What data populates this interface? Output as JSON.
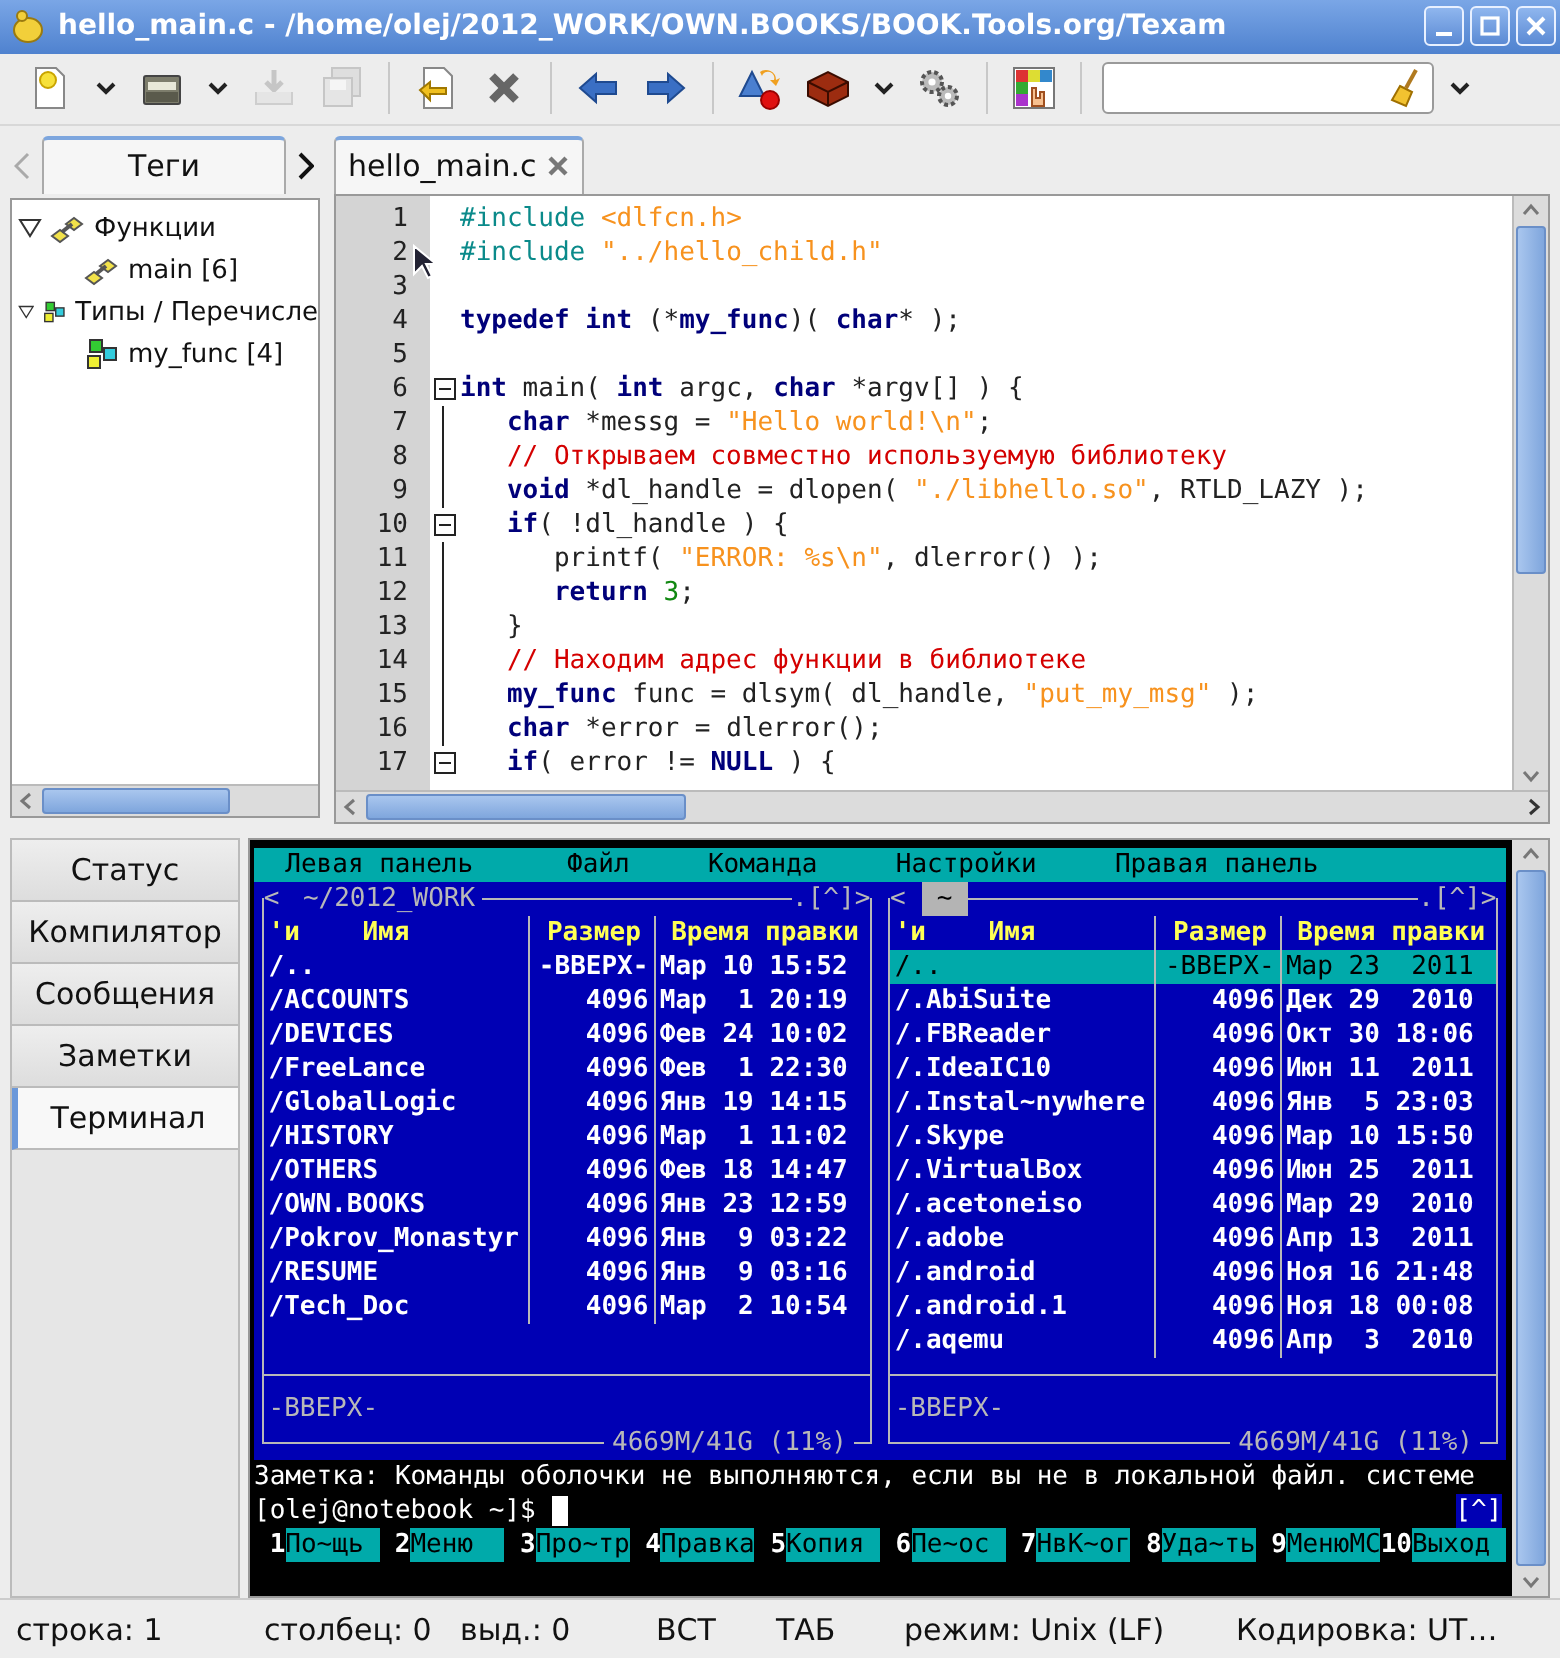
{
  "window": {
    "title": "hello_main.c - /home/olej/2012_WORK/OWN.BOOKS/BOOK.Tools.org/Texam"
  },
  "toolbar": {
    "buttons": [
      {
        "disabled": false
      },
      {
        "disabled": false
      },
      {
        "disabled": true
      },
      {
        "disabled": true
      },
      {
        "disabled": false
      },
      {
        "disabled": false
      },
      {
        "disabled": false
      },
      {
        "disabled": false
      },
      {
        "disabled": false
      },
      {
        "disabled": false
      },
      {
        "disabled": false
      },
      {
        "disabled": false
      }
    ]
  },
  "sidebar": {
    "tab": {
      "label": "Теги",
      "selected": true
    },
    "tree": [
      {
        "label": "Функции",
        "kind": "function",
        "expanded": true,
        "children": [
          {
            "label": "main [6]",
            "kind": "function"
          }
        ]
      },
      {
        "label": "Типы / Перечисле",
        "kind": "type",
        "expanded": true,
        "children": [
          {
            "label": "my_func [4]",
            "kind": "type"
          }
        ]
      }
    ]
  },
  "editor": {
    "tabs": [
      {
        "label": "hello_main.c",
        "selected": true
      }
    ],
    "lines": [
      {
        "number": "1",
        "fold": false,
        "tokens": [
          {
            "text": "#include ",
            "kind": "pre"
          },
          {
            "text": "<dlfcn.h>",
            "kind": "str"
          }
        ]
      },
      {
        "number": "2",
        "fold": false,
        "tokens": [
          {
            "text": "#include ",
            "kind": "pre"
          },
          {
            "text": "\"../hello_child.h\"",
            "kind": "str"
          }
        ]
      },
      {
        "number": "3",
        "fold": false
      },
      {
        "number": "4",
        "fold": false,
        "tokens": [
          {
            "text": "typedef int",
            "kind": "kw"
          },
          {
            "text": " (*",
            "kind": "tx"
          },
          {
            "text": "my_func",
            "kind": "kw"
          },
          {
            "text": ")( ",
            "kind": "tx"
          },
          {
            "text": "char",
            "kind": "kw"
          },
          {
            "text": "* );",
            "kind": "tx"
          }
        ]
      },
      {
        "number": "5",
        "fold": false
      },
      {
        "number": "6",
        "fold": true,
        "tokens": [
          {
            "text": "int",
            "kind": "kw"
          },
          {
            "text": " main( ",
            "kind": "tx"
          },
          {
            "text": "int",
            "kind": "kw"
          },
          {
            "text": " argc, ",
            "kind": "tx"
          },
          {
            "text": "char",
            "kind": "kw"
          },
          {
            "text": " *argv[] ) {",
            "kind": "tx"
          }
        ]
      },
      {
        "number": "7",
        "fold": false,
        "tokens": [
          {
            "text": "   char",
            "kind": "kw"
          },
          {
            "text": " *messg = ",
            "kind": "tx"
          },
          {
            "text": "\"Hello world!\\n\"",
            "kind": "str"
          },
          {
            "text": ";",
            "kind": "tx"
          }
        ]
      },
      {
        "number": "8",
        "fold": false,
        "tokens": [
          {
            "text": "   // Открываем совместно используемую библиотеку",
            "kind": "cm"
          }
        ]
      },
      {
        "number": "9",
        "fold": false,
        "tokens": [
          {
            "text": "   void",
            "kind": "kw"
          },
          {
            "text": " *dl_handle = dlopen( ",
            "kind": "tx"
          },
          {
            "text": "\"./libhello.so\"",
            "kind": "str"
          },
          {
            "text": ", RTLD_LAZY );",
            "kind": "tx"
          }
        ]
      },
      {
        "number": "10",
        "fold": true,
        "tokens": [
          {
            "text": "   if",
            "kind": "kw"
          },
          {
            "text": "( !dl_handle ) {",
            "kind": "tx"
          }
        ]
      },
      {
        "number": "11",
        "fold": false,
        "tokens": [
          {
            "text": "      printf( ",
            "kind": "tx"
          },
          {
            "text": "\"ERROR: %s\\n\"",
            "kind": "str"
          },
          {
            "text": ", dlerror() );",
            "kind": "tx"
          }
        ]
      },
      {
        "number": "12",
        "fold": false,
        "tokens": [
          {
            "text": "      return",
            "kind": "kw"
          },
          {
            "text": " 3",
            "kind": "num"
          },
          {
            "text": ";",
            "kind": "tx"
          }
        ]
      },
      {
        "number": "13",
        "fold": false,
        "tokens": [
          {
            "text": "   }",
            "kind": "tx"
          }
        ]
      },
      {
        "number": "14",
        "fold": false,
        "tokens": [
          {
            "text": "   // Находим адрес функции в библиотеке",
            "kind": "cm"
          }
        ]
      },
      {
        "number": "15",
        "fold": false,
        "tokens": [
          {
            "text": "   my_func",
            "kind": "kw"
          },
          {
            "text": " func = dlsym( dl_handle, ",
            "kind": "tx"
          },
          {
            "text": "\"put_my_msg\"",
            "kind": "str"
          },
          {
            "text": " );",
            "kind": "tx"
          }
        ]
      },
      {
        "number": "16",
        "fold": false,
        "tokens": [
          {
            "text": "   char",
            "kind": "kw"
          },
          {
            "text": " *error = dlerror();",
            "kind": "tx"
          }
        ]
      },
      {
        "number": "17",
        "fold": true,
        "tokens": [
          {
            "text": "   if",
            "kind": "kw"
          },
          {
            "text": "( error != ",
            "kind": "tx"
          },
          {
            "text": "NULL",
            "kind": "kw"
          },
          {
            "text": " ) {",
            "kind": "tx"
          }
        ]
      }
    ]
  },
  "bottom_tabs": [
    {
      "label": "Статус",
      "selected": false
    },
    {
      "label": "Компилятор",
      "selected": false
    },
    {
      "label": "Сообщения",
      "selected": false
    },
    {
      "label": "Заметки",
      "selected": false
    },
    {
      "label": "Терминал",
      "selected": true
    }
  ],
  "terminal": {
    "menu": [
      "Левая панель",
      "Файл",
      "Команда",
      "Настройки",
      "Правая панель"
    ],
    "panels": [
      {
        "nav_left": "<",
        "path": "~/2012_WORK",
        "path_selected": false,
        "nav_right": ".[^]>",
        "columns": [
          "'и",
          "Имя",
          "Размер",
          "Время правки"
        ],
        "info": "-ВВЕРХ-",
        "disk": "4669M/41G (11%)",
        "rows": [
          {
            "name": "/..",
            "size": "-ВВЕРХ-",
            "time": "Мар 10 15:52",
            "selected": false
          },
          {
            "name": "/ACCOUNTS",
            "size": "4096",
            "time": "Мар  1 20:19",
            "selected": false
          },
          {
            "name": "/DEVICES",
            "size": "4096",
            "time": "Фев 24 10:02",
            "selected": false
          },
          {
            "name": "/FreeLance",
            "size": "4096",
            "time": "Фев  1 22:30",
            "selected": false
          },
          {
            "name": "/GlobalLogic",
            "size": "4096",
            "time": "Янв 19 14:15",
            "selected": false
          },
          {
            "name": "/HISTORY",
            "size": "4096",
            "time": "Мар  1 11:02",
            "selected": false
          },
          {
            "name": "/OTHERS",
            "size": "4096",
            "time": "Фев 18 14:47",
            "selected": false
          },
          {
            "name": "/OWN.BOOKS",
            "size": "4096",
            "time": "Янв 23 12:59",
            "selected": false
          },
          {
            "name": "/Pokrov_Monastyr",
            "size": "4096",
            "time": "Янв  9 03:22",
            "selected": false
          },
          {
            "name": "/RESUME",
            "size": "4096",
            "time": "Янв  9 03:16",
            "selected": false
          },
          {
            "name": "/Tech_Doc",
            "size": "4096",
            "time": "Мар  2 10:54",
            "selected": false
          }
        ]
      },
      {
        "nav_left": "<",
        "path": "~",
        "path_selected": true,
        "nav_right": ".[^]>",
        "columns": [
          "'и",
          "Имя",
          "Размер",
          "Время правки"
        ],
        "info": "-ВВЕРХ-",
        "disk": "4669M/41G (11%)",
        "rows": [
          {
            "name": "/..",
            "size": "-ВВЕРХ-",
            "time": "Мар 23  2011",
            "selected": true
          },
          {
            "name": "/.AbiSuite",
            "size": "4096",
            "time": "Дек 29  2010",
            "selected": false
          },
          {
            "name": "/.FBReader",
            "size": "4096",
            "time": "Окт 30 18:06",
            "selected": false
          },
          {
            "name": "/.IdeaIC10",
            "size": "4096",
            "time": "Июн 11  2011",
            "selected": false
          },
          {
            "name": "/.Instal~nywhere",
            "size": "4096",
            "time": "Янв  5 23:03",
            "selected": false
          },
          {
            "name": "/.Skype",
            "size": "4096",
            "time": "Мар 10 15:50",
            "selected": false
          },
          {
            "name": "/.VirtualBox",
            "size": "4096",
            "time": "Июн 25  2011",
            "selected": false
          },
          {
            "name": "/.acetoneiso",
            "size": "4096",
            "time": "Мар 29  2010",
            "selected": false
          },
          {
            "name": "/.adobe",
            "size": "4096",
            "time": "Апр 13  2011",
            "selected": false
          },
          {
            "name": "/.android",
            "size": "4096",
            "time": "Ноя 16 21:48",
            "selected": false
          },
          {
            "name": "/.android.1",
            "size": "4096",
            "time": "Ноя 18 00:08",
            "selected": false
          },
          {
            "name": "/.aqemu",
            "size": "4096",
            "time": "Апр  3  2010",
            "selected": false
          }
        ]
      }
    ],
    "note": "Заметка: Команды оболочки не выполняются, если вы не в локальной файл. системе",
    "prompt": "[olej@notebook ~]$",
    "scroll_marker": "[^]",
    "keys": [
      {
        "num": "1",
        "label": "По~щь"
      },
      {
        "num": "2",
        "label": "Меню"
      },
      {
        "num": "3",
        "label": "Про~тр"
      },
      {
        "num": "4",
        "label": "Правка"
      },
      {
        "num": "5",
        "label": "Копия"
      },
      {
        "num": "6",
        "label": "Пе~ос"
      },
      {
        "num": "7",
        "label": "НвК~ог"
      },
      {
        "num": "8",
        "label": "Уда~ть"
      },
      {
        "num": "9",
        "label": "МенюМС"
      },
      {
        "num": "10",
        "label": "Выход"
      }
    ]
  },
  "status_bar": [
    "строка: 1",
    "столбец: 0",
    "выд.: 0",
    "ВСТ",
    "ТАБ",
    "режим: Unix (LF)",
    "Кодировка: UT…"
  ]
}
